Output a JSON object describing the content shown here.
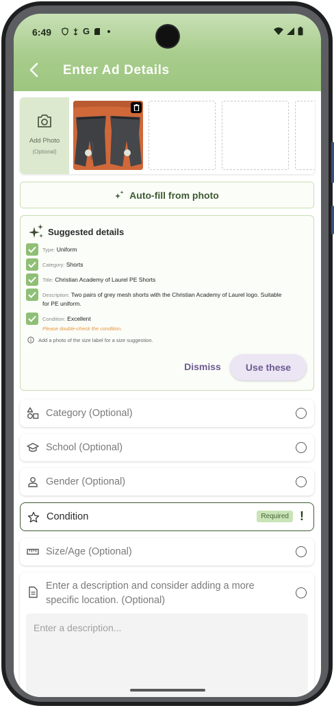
{
  "status": {
    "time": "6:49",
    "g_label": "G"
  },
  "appbar": {
    "title": "Enter Ad Details"
  },
  "photos": {
    "add_label": "Add Photo",
    "add_sub": "(Optional)"
  },
  "autofill": {
    "label": "Auto-fill from photo"
  },
  "suggested": {
    "title": "Suggested details",
    "items": [
      {
        "key": "Type:",
        "value": "Uniform"
      },
      {
        "key": "Category:",
        "value": "Shorts"
      },
      {
        "key": "Title:",
        "value": "Christian Academy of Laurel PE Shorts"
      },
      {
        "key": "Description:",
        "value": "Two pairs of grey mesh shorts with the Christian Academy of Laurel logo. Suitable for PE uniform."
      },
      {
        "key": "Condition:",
        "value": "Excellent"
      }
    ],
    "warning": "Please double-check the condition.",
    "info": "Add a photo of the size label for a size suggestion.",
    "dismiss": "Dismiss",
    "use": "Use these"
  },
  "fields": {
    "category": "Category (Optional)",
    "school": "School (Optional)",
    "gender": "Gender (Optional)",
    "condition": "Condition",
    "required": "Required",
    "size": "Size/Age (Optional)",
    "description": "Enter a description and consider adding a more specific location. (Optional)",
    "description_placeholder": "Enter a description..."
  },
  "colors": {
    "accent_green": "#9dc680",
    "purple": "#6c5a8e",
    "warning": "#e8943a"
  }
}
